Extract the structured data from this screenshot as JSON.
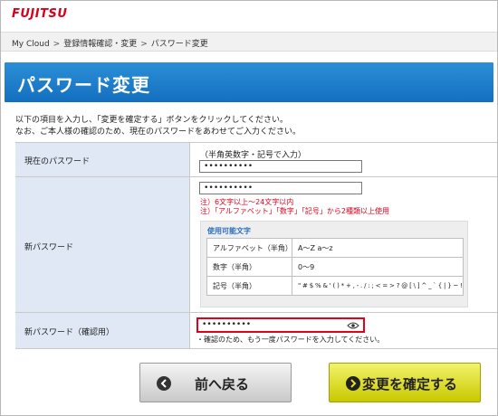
{
  "header": {
    "logo": "FUJITSU"
  },
  "breadcrumb": [
    "My Cloud",
    "登録情報確認・変更",
    "パスワード変更"
  ],
  "breadcrumb_sep": ">",
  "page_title": "パスワード変更",
  "intro": {
    "line1": "以下の項目を入力し、「変更を確定する」ボタンをクリックしてください。",
    "line2": "なお、ご本人様の確認のため、現在のパスワードをあわせてご入力ください。"
  },
  "form": {
    "current": {
      "label": "現在のパスワード",
      "hint": "（半角英数字・記号で入力）",
      "value": "••••••••••"
    },
    "new": {
      "label": "新パスワード",
      "value": "••••••••••",
      "note1": "注）6文字以上～24文字以内",
      "note2": "注）「アルファベット」「数字」「記号」から2種類以上使用",
      "chars_title": "使用可能文字",
      "chars": [
        {
          "k": "アルファベット（半角）",
          "v": "A～Z a～z"
        },
        {
          "k": "数字（半角）",
          "v": "0～9"
        },
        {
          "k": "記号（半角）",
          "v": "\" # $ % & ' ( ) * + , - . / : ; < = > ? @ [ \\ ] ^ _ ` { | } ~ !"
        }
      ]
    },
    "confirm": {
      "label": "新パスワード（確認用）",
      "value": "••••••••••",
      "note": "・確認のため、もう一度パスワードを入力してください。"
    }
  },
  "buttons": {
    "back": "前へ戻る",
    "ok": "変更を確定する"
  },
  "colors": {
    "brand": "#d8001d",
    "title_bar": "#1a7acb",
    "label_bg": "#dfe8f4",
    "highlight": "#e2001a",
    "ok_button": "#e4e42a"
  }
}
